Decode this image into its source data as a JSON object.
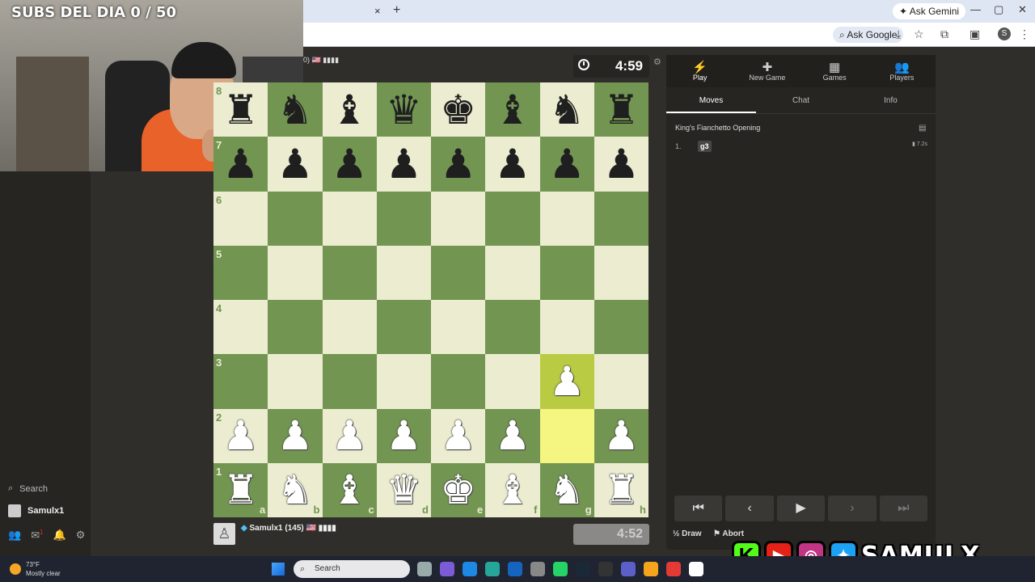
{
  "browser": {
    "tab_close": "×",
    "tab_new": "+",
    "gemini_label": "Ask Gemini",
    "ask_google_label": "Ask Google",
    "profile_initial": "S",
    "window_controls": [
      "—",
      "▢",
      "✕"
    ]
  },
  "overlay": {
    "subs_text": "SUBS DEL DIA 0 / 50",
    "social_handle": "SAMULX"
  },
  "sidebar": {
    "search_label": "Search",
    "username": "Samulx1",
    "mail_badge": "1"
  },
  "top_player": {
    "tag_text": "0) 🇺🇸 ▮▮▮▮",
    "clock": "4:59"
  },
  "bottom_player": {
    "name": "Samulx1 (145) 🇺🇸 ▮▮▮▮",
    "clock": "4:52"
  },
  "board": {
    "ranks": [
      "8",
      "7",
      "6",
      "5",
      "4",
      "3",
      "2",
      "1"
    ],
    "files": [
      "a",
      "b",
      "c",
      "d",
      "e",
      "f",
      "g",
      "h"
    ],
    "last_move_from": "g2",
    "last_move_to": "g3",
    "position": [
      [
        "bR",
        "bN",
        "bB",
        "bQ",
        "bK",
        "bB",
        "bN",
        "bR"
      ],
      [
        "bP",
        "bP",
        "bP",
        "bP",
        "bP",
        "bP",
        "bP",
        "bP"
      ],
      [
        "",
        "",
        "",
        "",
        "",
        "",
        "",
        ""
      ],
      [
        "",
        "",
        "",
        "",
        "",
        "",
        "",
        ""
      ],
      [
        "",
        "",
        "",
        "",
        "",
        "",
        "",
        ""
      ],
      [
        "",
        "",
        "",
        "",
        "",
        "",
        "wP",
        ""
      ],
      [
        "wP",
        "wP",
        "wP",
        "wP",
        "wP",
        "wP",
        "",
        "wP"
      ],
      [
        "wR",
        "wN",
        "wB",
        "wQ",
        "wK",
        "wB",
        "wN",
        "wR"
      ]
    ]
  },
  "panel": {
    "tabs": [
      {
        "label": "Play",
        "icon": "⚡"
      },
      {
        "label": "New Game",
        "icon": "✚"
      },
      {
        "label": "Games",
        "icon": "▦"
      },
      {
        "label": "Players",
        "icon": "👥"
      }
    ],
    "subtabs": [
      "Moves",
      "Chat",
      "Info"
    ],
    "opening": "King's Fianchetto Opening",
    "moves": [
      {
        "num": "1.",
        "white": "g3",
        "time": "▮ 7.2s"
      }
    ],
    "controls": [
      "⏮",
      "‹",
      "▶",
      "›",
      "⏭"
    ],
    "draw_label": "Draw",
    "abort_label": "Abort"
  },
  "taskbar": {
    "temp": "73°F",
    "condition": "Mostly clear",
    "search_label": "Search"
  },
  "colors": {
    "light_square": "#ebecd0",
    "dark_square": "#739552",
    "highlight": "#f5f682"
  }
}
